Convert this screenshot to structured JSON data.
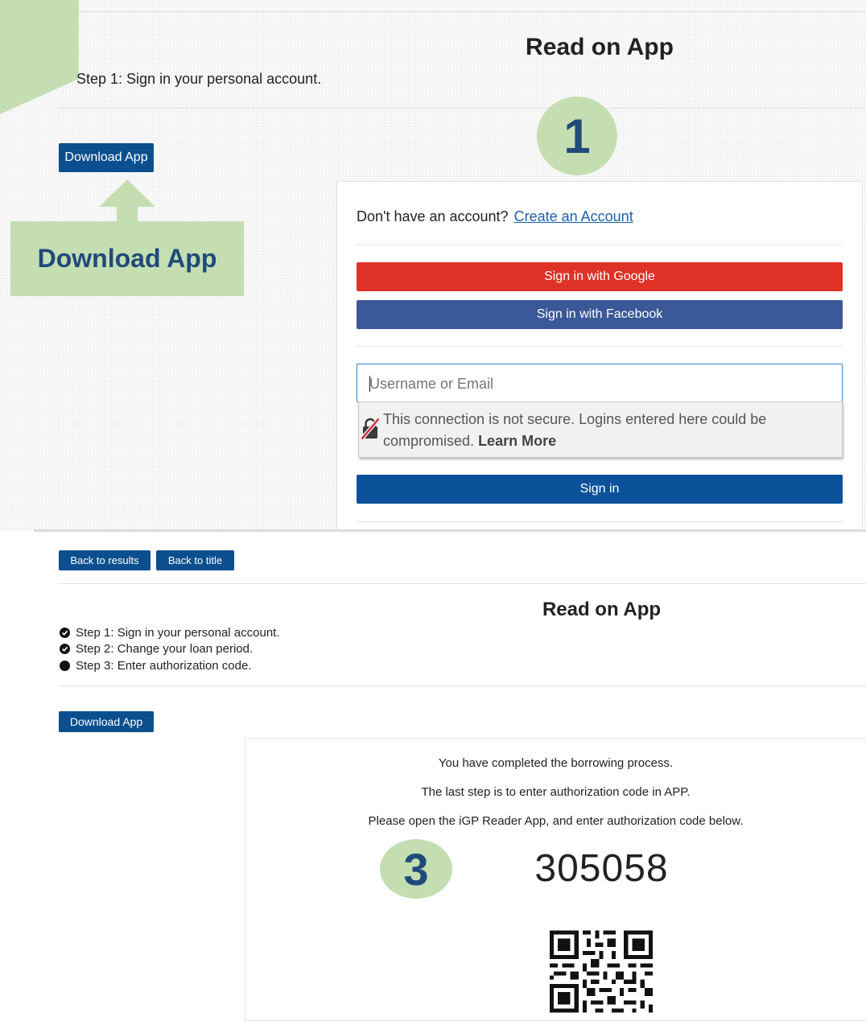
{
  "top": {
    "title": "Read on App",
    "step_text": "Step 1: Sign in your personal account.",
    "download_button": "Download App",
    "callout_label": "Download App",
    "badge_number": "1",
    "login": {
      "no_account_text": "Don't have an account?",
      "create_account_link": "Create an Account",
      "google_button": "Sign in with Google",
      "facebook_button": "Sign in with Facebook",
      "username_placeholder": "Username or Email",
      "warning_text": "This connection is not secure. Logins entered here could be compromised.",
      "learn_more": "Learn More",
      "sign_in_button": "Sign in"
    }
  },
  "bottom": {
    "back_to_results": "Back to results",
    "back_to_title": "Back to title",
    "title": "Read on App",
    "steps": [
      {
        "label": "Step 1: Sign in your personal account.",
        "state": "done"
      },
      {
        "label": "Step 2: Change your loan period.",
        "state": "done"
      },
      {
        "label": "Step 3: Enter authorization code.",
        "state": "current"
      }
    ],
    "download_button": "Download App",
    "completed_text": "You have completed the borrowing process.",
    "last_step_text": "The last step is to enter authorization code in APP.",
    "instruction_text": "Please open the iGP Reader App, and enter authorization code below.",
    "badge_number": "3",
    "auth_code": "305058"
  },
  "colors": {
    "primary_blue": "#0b4f8f",
    "google_red": "#de3226",
    "facebook_blue": "#3b5898",
    "callout_green": "#c4deb2",
    "badge_text": "#1f4a7a"
  },
  "icons": {
    "warning": "insecure-lock-icon",
    "step_done": "check-circle-icon",
    "step_current": "filled-circle-icon",
    "qr": "qr-code-icon"
  }
}
